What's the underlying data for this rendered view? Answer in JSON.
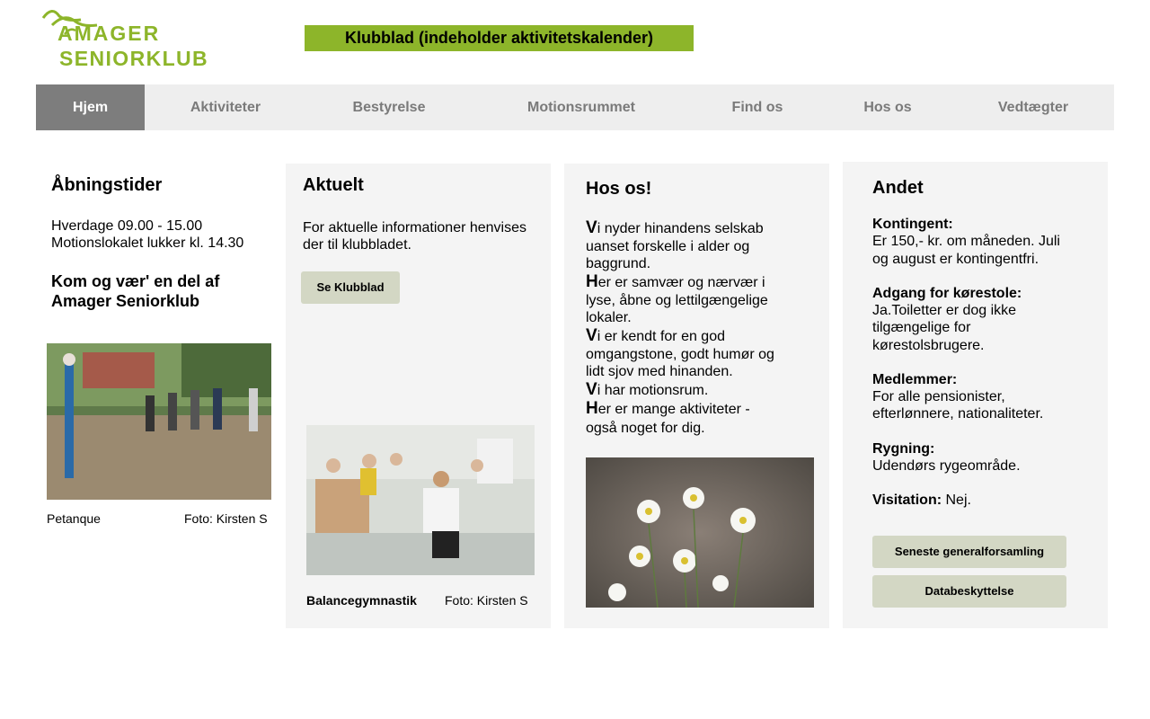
{
  "logo": {
    "line1": "AMAGER",
    "line2": "SENIORKLUB",
    "color": "#8db52a"
  },
  "banner": {
    "label": "Klubblad (indeholder aktivitetskalender)"
  },
  "nav": {
    "items": [
      {
        "label": "Hjem",
        "active": true
      },
      {
        "label": "Aktiviteter"
      },
      {
        "label": "Bestyrelse"
      },
      {
        "label": "Motionsrummet"
      },
      {
        "label": "Find os"
      },
      {
        "label": "Hos os"
      },
      {
        "label": "Vedtægter"
      }
    ]
  },
  "col1": {
    "title": "Åbningstider",
    "hours1": "Hverdage 09.00 - 15.00",
    "hours2": "Motionslokalet lukker kl. 14.30",
    "invite1": "Kom og vær' en del af",
    "invite2": "Amager Seniorklub",
    "photo_caption": "Petanque",
    "photo_credit": "Foto: Kirsten S"
  },
  "col2": {
    "title": "Aktuelt",
    "text1": "For aktuelle informationer henvises",
    "text2": "der til klubbladet.",
    "button": "Se Klubblad",
    "photo_caption": "Balancegymnastik",
    "photo_credit": "Foto: Kirsten S"
  },
  "col3": {
    "title": "Hos os!",
    "l1_cap": "V",
    "l1a": "i nyder hinandens selskab",
    "l1b": "uanset forskelle i alder og",
    "l1c": "baggrund.",
    "l2_cap": "H",
    "l2a": "er er samvær og nærvær i",
    "l2b": "lyse, åbne og lettilgængelige",
    "l2c": "lokaler.",
    "l3_cap": "V",
    "l3a": "i er kendt for en god",
    "l3b": "omgangstone, godt humør og",
    "l3c": "lidt sjov med hinanden.",
    "l4_cap": "V",
    "l4a": "i har motionsrum.",
    "l5_cap": "H",
    "l5a": "er er mange aktiviteter -",
    "l5b": "også noget for dig."
  },
  "col4": {
    "title": "Andet",
    "k_label": "Kontingent:",
    "k_text1": "Er 150,- kr. om måneden. Juli",
    "k_text2": "og august er kontingentfri.",
    "a_label": "Adgang for kørestole:",
    "a_text1": "Ja.Toiletter er dog ikke",
    "a_text2": "tilgængelige for",
    "a_text3": "kørestolsbrugere.",
    "m_label": "Medlemmer:",
    "m_text1": "For alle pensionister,",
    "m_text2": "efterlønnere, nationaliteter.",
    "r_label": "Rygning:",
    "r_text": "Udendørs rygeområde.",
    "v_label": "Visitation:",
    "v_text": " Nej.",
    "btn1": "Seneste generalforsamling",
    "btn2": "Databeskyttelse"
  }
}
